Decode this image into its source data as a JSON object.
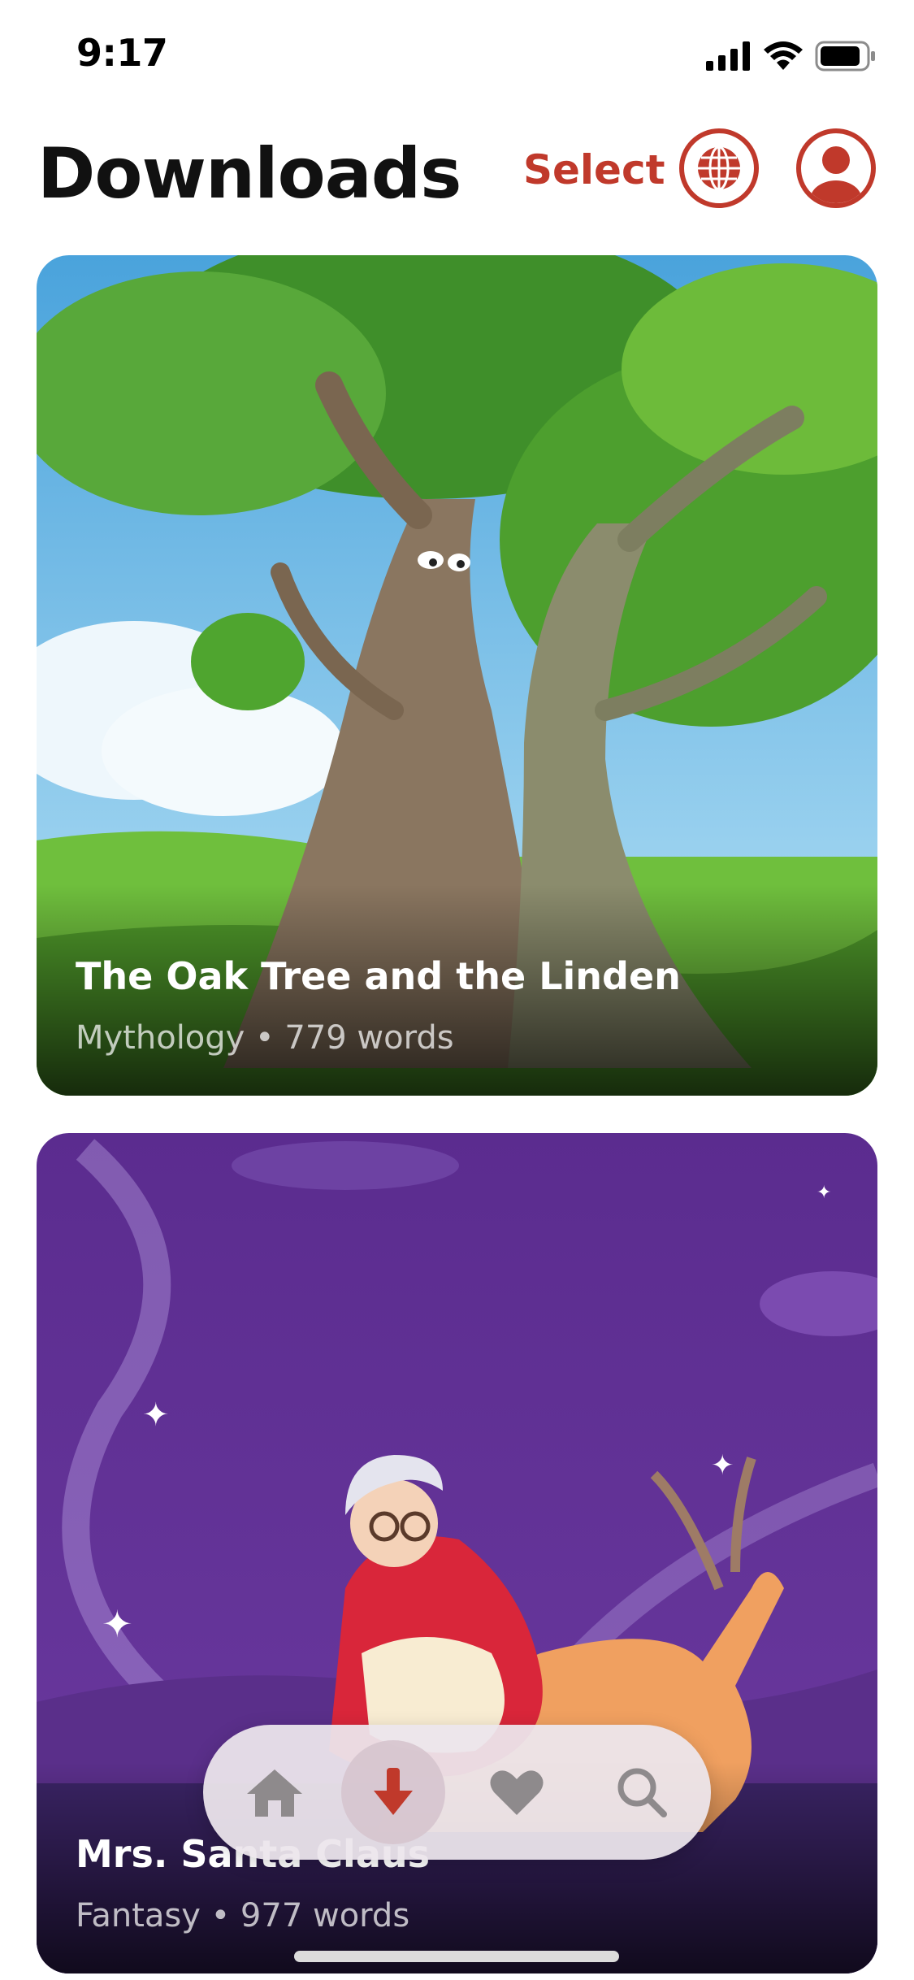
{
  "status_bar": {
    "time": "9:17",
    "icons": [
      "cellular-signal-icon",
      "wifi-icon",
      "battery-icon"
    ]
  },
  "header": {
    "title": "Downloads",
    "select_label": "Select",
    "icons": [
      "globe-icon",
      "profile-icon"
    ]
  },
  "stories": [
    {
      "title": "The Oak Tree and the Linden",
      "meta": "Mythology • 779 words"
    },
    {
      "title": "Mrs. Santa Claus",
      "meta": "Fantasy • 977 words"
    }
  ],
  "tab_bar": {
    "items": [
      "home-icon",
      "download-icon",
      "heart-icon",
      "search-icon"
    ],
    "active": "download-icon"
  },
  "colors": {
    "accent": "#c0392b",
    "title_text": "#111111",
    "card_2_background": "#5b2c8f"
  }
}
